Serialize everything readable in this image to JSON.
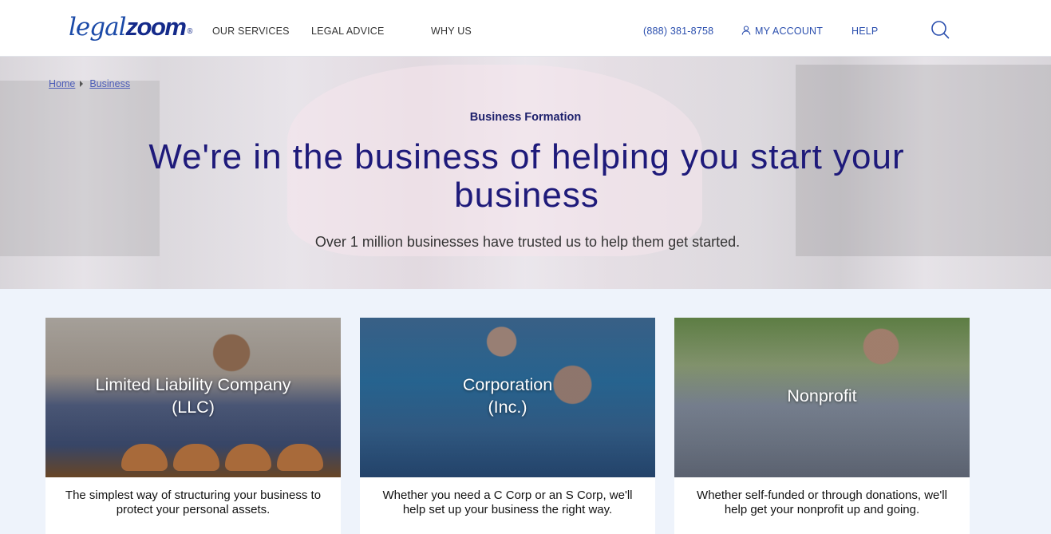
{
  "header": {
    "logo_part1": "legal",
    "logo_part2": "zoom",
    "logo_mark": "®",
    "nav": [
      "OUR SERVICES",
      "LEGAL ADVICE",
      "WHY US"
    ],
    "phone": "(888) 381-8758",
    "account": "MY ACCOUNT",
    "help": "HELP",
    "search_icon": "search-icon",
    "account_icon": "user-icon"
  },
  "breadcrumb": [
    "Home",
    "Business"
  ],
  "hero": {
    "eyebrow": "Business Formation",
    "title": "We're in the business of helping you start your business",
    "subtitle": "Over 1 million businesses have trusted us to help them get started."
  },
  "cards": [
    {
      "title_line1": "Limited Liability Company",
      "title_line2": "(LLC)",
      "description": "The simplest way of structuring your business to protect your personal assets."
    },
    {
      "title_line1": "Corporation",
      "title_line2": "(Inc.)",
      "description": "Whether you need a C Corp or an S Corp, we'll help set up your business the right way."
    },
    {
      "title_line1": "Nonprofit",
      "title_line2": "",
      "description": "Whether self-funded or through donations, we'll help get your nonprofit up and going."
    }
  ],
  "colors": {
    "brand_blue": "#1b4aa8",
    "title_navy": "#1e1a7a",
    "link_blue": "#2b4fae",
    "section_bg": "#eef3fb"
  }
}
